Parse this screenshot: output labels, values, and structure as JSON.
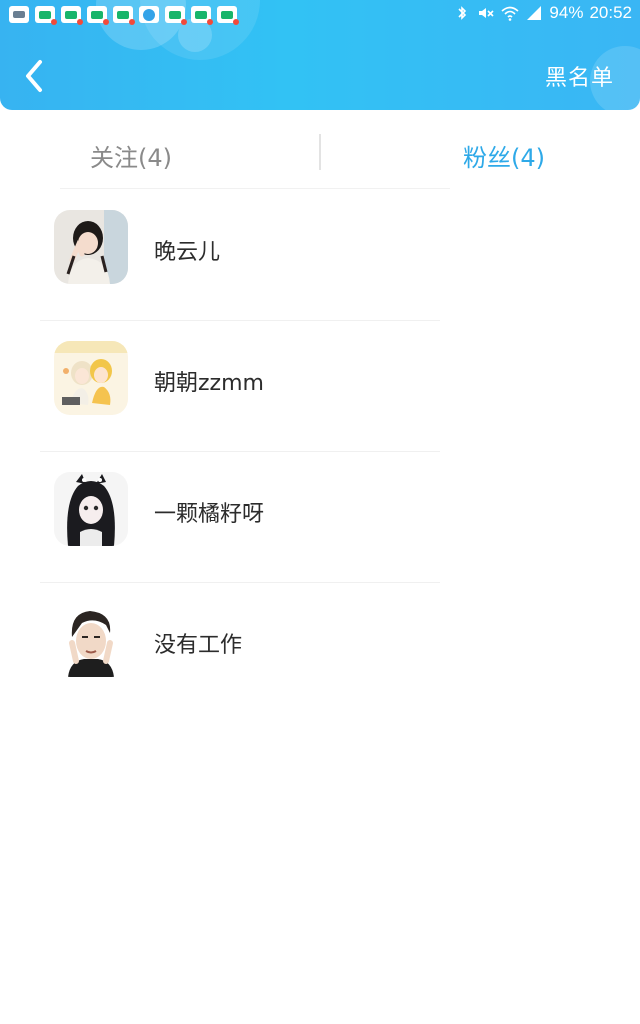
{
  "status_bar": {
    "battery": "94%",
    "time": "20:52",
    "notification_icons": [
      "gallery",
      "wechat",
      "wechat",
      "wechat",
      "wechat",
      "circle-app",
      "wechat",
      "wechat",
      "wechat"
    ]
  },
  "header": {
    "back_icon": "chevron-left-icon",
    "right_action": "黑名单"
  },
  "tabs": {
    "following": "关注(4)",
    "fans": "粉丝(4)",
    "active": "fans"
  },
  "fans": [
    {
      "name": "晚云儿"
    },
    {
      "name": "朝朝zzmm"
    },
    {
      "name": "一颗橘籽呀"
    },
    {
      "name": "没有工作"
    }
  ],
  "colors": {
    "header_gradient_start": "#37b3f1",
    "header_gradient_end": "#3ab6f4",
    "active_tab": "#2ea9e8",
    "inactive_tab": "#8a8a8a"
  }
}
